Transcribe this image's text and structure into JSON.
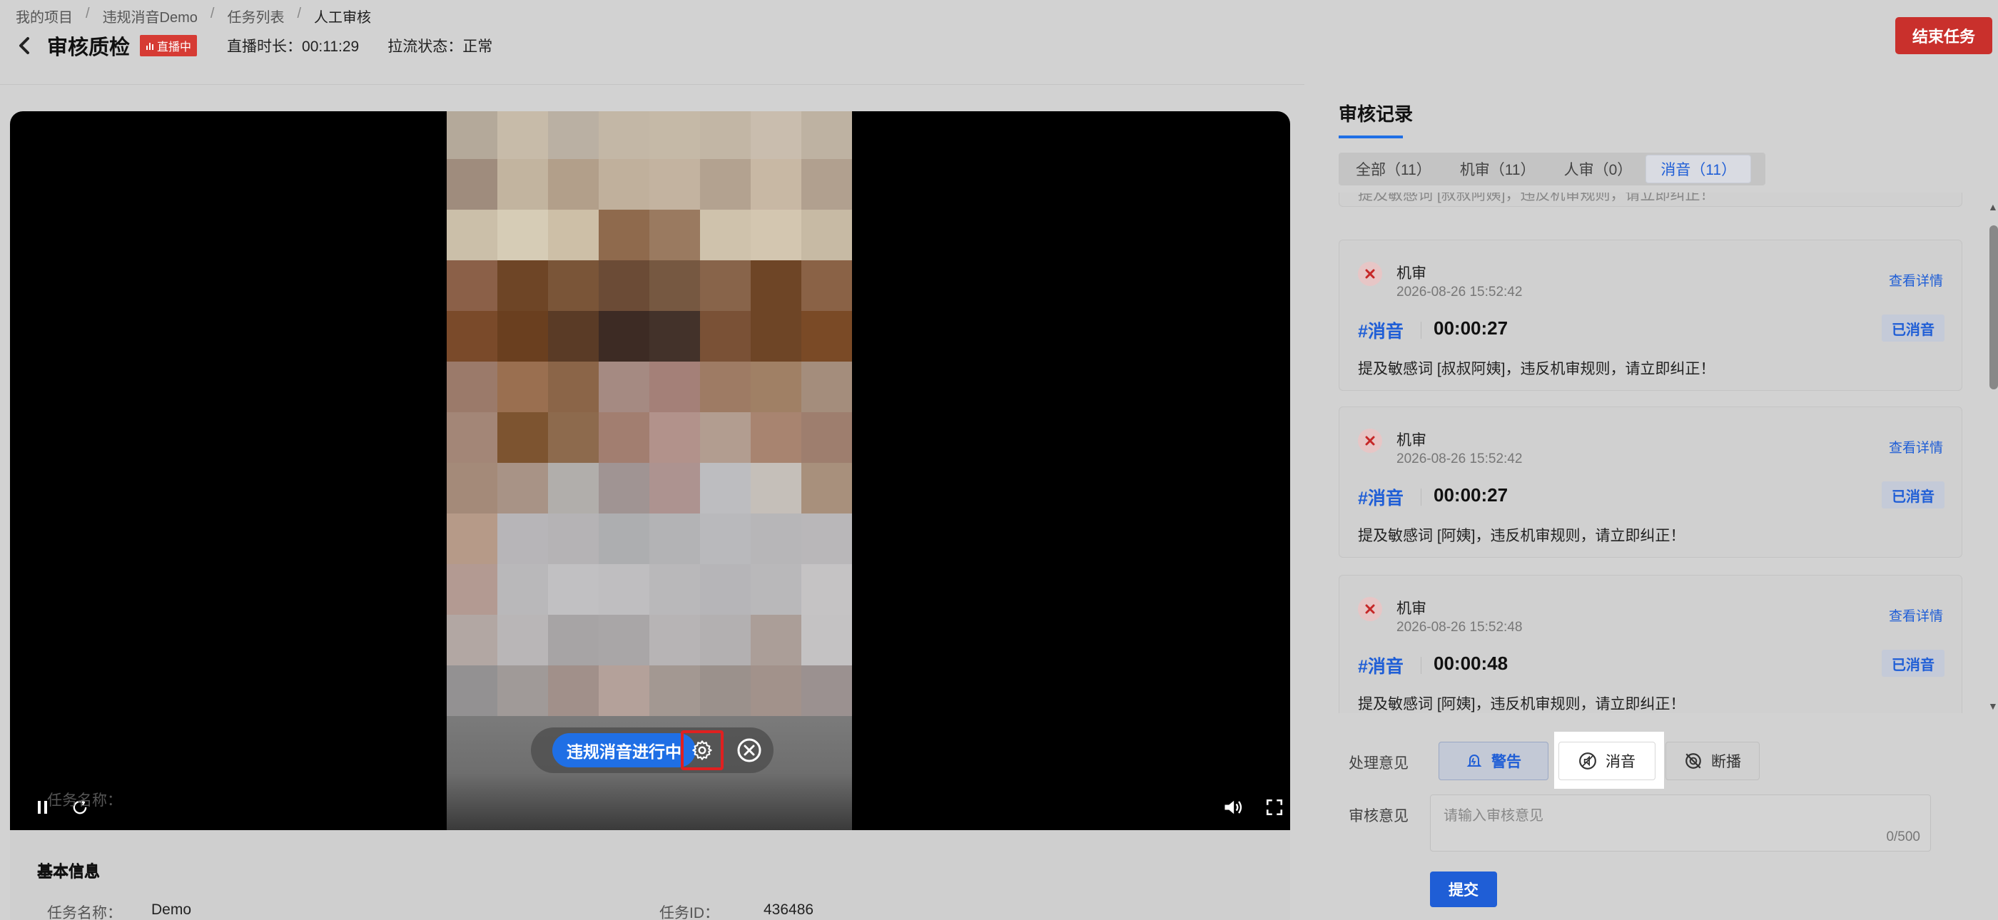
{
  "breadcrumb": [
    "我的项目",
    "违规消音Demo",
    "任务列表",
    "人工审核"
  ],
  "breadcrumb_sep": "/",
  "header": {
    "title": "审核质检",
    "live_badge": "直播中",
    "duration": "直播时长：00:11:29",
    "stream_status": "拉流状态：正常",
    "end_button": "结束任务"
  },
  "player": {
    "mute_status": "违规消音进行中"
  },
  "basic_info": {
    "title": "基本信息",
    "task_name_label": "任务名称：",
    "task_name": "Demo",
    "task_id_label": "任务ID：",
    "task_id": "436486"
  },
  "review": {
    "title": "审核记录",
    "tabs": [
      {
        "label": "全部（11）",
        "active": false
      },
      {
        "label": "机审（11）",
        "active": false
      },
      {
        "label": "人审（0）",
        "active": false
      },
      {
        "label": "消音（11）",
        "active": true
      }
    ],
    "top_partial_text": "提及敏感词 [叔叔阿姨]，违反机审规则，请立即纠正！",
    "records": [
      {
        "source": "机审",
        "time": "2026-08-26 15:52:42",
        "detail": "查看详情",
        "tag": "#消音",
        "timecode": "00:00:27",
        "status": "已消音",
        "desc": "提及敏感词 [叔叔阿姨]，违反机审规则，请立即纠正！"
      },
      {
        "source": "机审",
        "time": "2026-08-26 15:52:42",
        "detail": "查看详情",
        "tag": "#消音",
        "timecode": "00:00:27",
        "status": "已消音",
        "desc": "提及敏感词 [阿姨]，违反机审规则，请立即纠正！"
      },
      {
        "source": "机审",
        "time": "2026-08-26 15:52:48",
        "detail": "查看详情",
        "tag": "#消音",
        "timecode": "00:00:48",
        "status": "已消音",
        "desc": "提及敏感词 [阿姨]，违反机审规则，请立即纠正！"
      }
    ]
  },
  "action": {
    "opinion_label": "处理意见",
    "options": [
      "警告",
      "消音",
      "断播"
    ],
    "comment_label": "审核意见",
    "comment_placeholder": "请输入审核意见",
    "counter": "0/500",
    "submit": "提交"
  },
  "colors": {
    "accent": "#1f5ed6",
    "danger": "#c9302c",
    "live_badge": "#d63b34"
  },
  "icons": [
    "back-icon",
    "bar-chart-icon",
    "gear-icon",
    "close-circle-icon",
    "pause-icon",
    "refresh-icon",
    "volume-icon",
    "fullscreen-icon",
    "close-icon",
    "bell-icon",
    "mute-icon",
    "stop-broadcast-icon"
  ]
}
